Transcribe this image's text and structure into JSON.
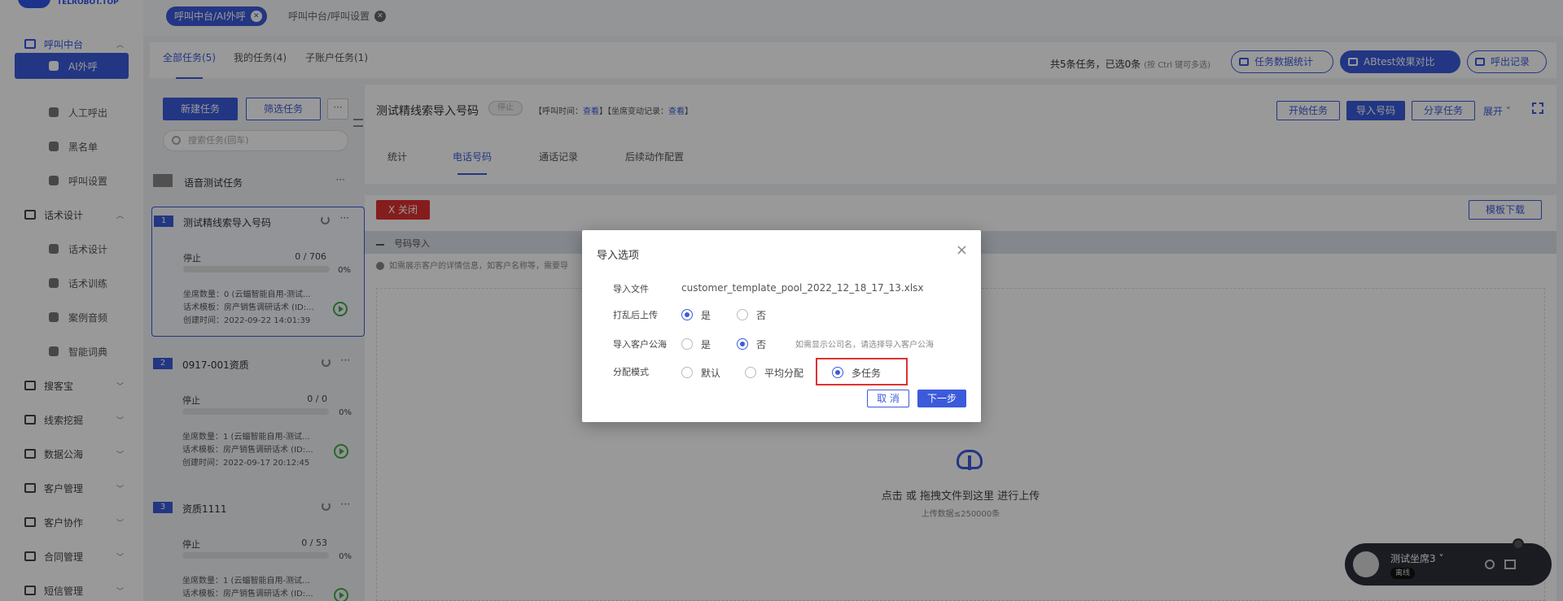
{
  "logo": {
    "text": "TELROBOT.TOP"
  },
  "sidebar": {
    "groups": [
      {
        "label": "呼叫中台",
        "icon": "monitor-icon",
        "expanded": true
      },
      {
        "label": "话术设计",
        "icon": "script-icon",
        "expanded": true
      },
      {
        "label": "搜客宝",
        "icon": "search-customer-icon"
      },
      {
        "label": "线索挖掘",
        "icon": "lead-icon"
      },
      {
        "label": "数据公海",
        "icon": "data-pool-icon"
      },
      {
        "label": "客户管理",
        "icon": "customer-icon"
      },
      {
        "label": "客户协作",
        "icon": "collab-icon"
      },
      {
        "label": "合同管理",
        "icon": "contract-icon"
      },
      {
        "label": "短信管理",
        "icon": "sms-icon"
      }
    ],
    "items": [
      {
        "label": "AI外呼",
        "icon": "phone-icon",
        "active": true
      },
      {
        "label": "人工呼出",
        "icon": "person-icon"
      },
      {
        "label": "黑名单",
        "icon": "warning-icon"
      },
      {
        "label": "呼叫设置",
        "icon": "sliders-icon"
      },
      {
        "label": "话术设计",
        "icon": "edit-icon"
      },
      {
        "label": "话术训练",
        "icon": "chat-icon"
      },
      {
        "label": "案例音频",
        "icon": "audio-icon"
      },
      {
        "label": "智能词典",
        "icon": "book-icon"
      }
    ]
  },
  "top_tabs": [
    {
      "label": "呼叫中台/AI外呼",
      "active": true
    },
    {
      "label": "呼叫中台/呼叫设置",
      "active": false
    }
  ],
  "filter": {
    "tabs": [
      "全部任务(5)",
      "我的任务(4)",
      "子账户任务(1)"
    ],
    "active_tab": 0,
    "summary": "共5条任务，已选0条",
    "summary_hint": "(按 Ctrl 键可多选)",
    "buttons": [
      "任务数据统计",
      "ABtest效果对比",
      "呼出记录"
    ]
  },
  "task_panel": {
    "new_task": "新建任务",
    "filter_task": "筛选任务",
    "more": "···",
    "search_placeholder": "搜索任务(回车)",
    "voice_test": "语音测试任务",
    "tasks": [
      {
        "num": "1",
        "name": "测试精线索导入号码",
        "status": "停止",
        "progress": "0 / 706",
        "pct": "0%",
        "seats": "坐席数量：0 (云蝠智能自用-测试...",
        "template": "话术模板：房产销售调研话术 (ID:...",
        "created": "创建时间：2022-09-22 14:01:39",
        "selected": true
      },
      {
        "num": "2",
        "name": "0917-001资质",
        "status": "停止",
        "progress": "0 / 0",
        "pct": "0%",
        "seats": "坐席数量：1 (云蝠智能自用-测试...",
        "template": "话术模板：房产销售调研话术 (ID:...",
        "created": "创建时间：2022-09-17 20:12:45",
        "selected": false
      },
      {
        "num": "3",
        "name": "资质1111",
        "status": "停止",
        "progress": "0 / 53",
        "pct": "0%",
        "seats": "坐席数量：1 (云蝠智能自用-测试...",
        "template": "话术模板：房产销售调研话术 (ID:...",
        "created": "",
        "selected": false
      }
    ]
  },
  "detail": {
    "title": "测试精线索导入号码",
    "status_tag": "停止",
    "meta_prefix": "【呼叫时间：",
    "meta_link1": "查看",
    "meta_mid": "】【坐席变动记录：",
    "meta_link2": "查看",
    "meta_suffix": "】",
    "buttons": [
      "开始任务",
      "导入号码",
      "分享任务"
    ],
    "expand": "展开 ˅",
    "tabs": [
      "统计",
      "电话号码",
      "通话记录",
      "后续动作配置"
    ],
    "active_tab": 1,
    "close_btn": "X  关闭",
    "template_btn": "模板下载",
    "import_label": "号码导入",
    "tip": "如需展示客户的详情信息，如客户名称等，需要导",
    "upload_text": "点击 或 拖拽文件到这里 进行上传",
    "upload_limit": "上传数据≤250000条"
  },
  "modal": {
    "title": "导入选项",
    "close": "×",
    "file_label": "导入文件",
    "file_value": "customer_template_pool_2022_12_18_17_13.xlsx",
    "shuffle_label": "打乱后上传",
    "shuffle_options": [
      "是",
      "否"
    ],
    "shuffle_selected": 0,
    "pool_label": "导入客户公海",
    "pool_options": [
      "是",
      "否"
    ],
    "pool_selected": 1,
    "pool_note": "如需显示公司名，请选择导入客户公海",
    "mode_label": "分配模式",
    "mode_options": [
      "默认",
      "平均分配",
      "多任务"
    ],
    "mode_selected": 2,
    "cancel": "取 消",
    "next": "下一步"
  },
  "seat_widget": {
    "name": "测试坐席3 ˅",
    "status": "离线"
  },
  "colors": {
    "primary": "#3b5bdb",
    "danger": "#e03131",
    "success": "#3cad4a"
  }
}
